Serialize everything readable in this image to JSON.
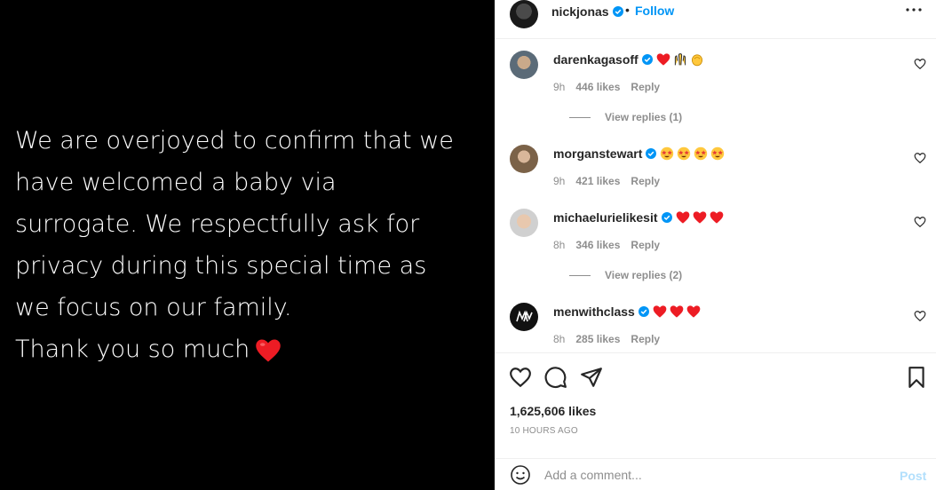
{
  "post": {
    "lines": [
      "We are overjoyed to confirm that we",
      "have welcomed a baby via",
      "surrogate. We respectfully ask for",
      "privacy during this special time as",
      "we focus on our family.",
      "Thank you so much"
    ]
  },
  "header": {
    "username": "nickjonas",
    "separator": "•",
    "follow_label": "Follow"
  },
  "comments": [
    {
      "username": "darenkagasoff",
      "emojis": [
        "red-heart",
        "raising-hands",
        "clapping-hands"
      ],
      "time": "9h",
      "likes": "446 likes",
      "reply": "Reply",
      "view_replies": "View replies (1)"
    },
    {
      "username": "morganstewart",
      "emojis": [
        "star-struck",
        "star-struck",
        "star-struck",
        "star-struck"
      ],
      "time": "9h",
      "likes": "421 likes",
      "reply": "Reply"
    },
    {
      "username": "michaelurielikesit",
      "emojis": [
        "red-heart",
        "red-heart",
        "red-heart"
      ],
      "time": "8h",
      "likes": "346 likes",
      "reply": "Reply",
      "view_replies": "View replies (2)"
    },
    {
      "username": "menwithclass",
      "emojis": [
        "red-heart",
        "red-heart",
        "red-heart"
      ],
      "time": "8h",
      "likes": "285 likes",
      "reply": "Reply"
    }
  ],
  "engagement": {
    "likes": "1,625,606 likes",
    "time_ago": "10 HOURS AGO"
  },
  "comment_box": {
    "placeholder": "Add a comment...",
    "post_label": "Post"
  },
  "colors": {
    "link_blue": "#0095f6",
    "post_disabled": "#b2dffc",
    "heart_red": "#ed1c24",
    "muted": "#8e8e8e"
  }
}
